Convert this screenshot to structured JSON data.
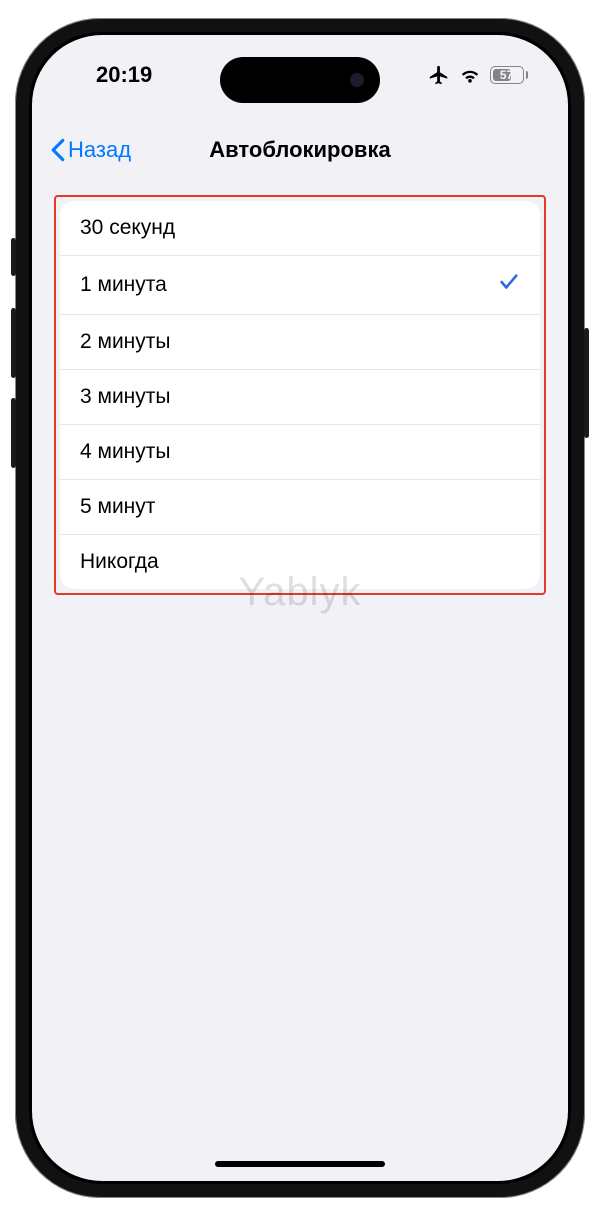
{
  "status": {
    "time": "20:19",
    "battery_percent": "57"
  },
  "nav": {
    "back_label": "Назад",
    "title": "Автоблокировка"
  },
  "options": [
    {
      "label": "30 секунд",
      "selected": false
    },
    {
      "label": "1 минута",
      "selected": true
    },
    {
      "label": "2 минуты",
      "selected": false
    },
    {
      "label": "3 минуты",
      "selected": false
    },
    {
      "label": "4 минуты",
      "selected": false
    },
    {
      "label": "5 минут",
      "selected": false
    },
    {
      "label": "Никогда",
      "selected": false
    }
  ],
  "watermark": "Yablyk",
  "colors": {
    "ios_blue": "#007aff",
    "highlight_red": "#e43a2a",
    "bg": "#f2f1f6"
  },
  "icons": {
    "airplane": "airplane-icon",
    "wifi": "wifi-icon",
    "battery": "battery-icon",
    "chevron_back": "chevron-left-icon",
    "checkmark": "checkmark-icon"
  }
}
